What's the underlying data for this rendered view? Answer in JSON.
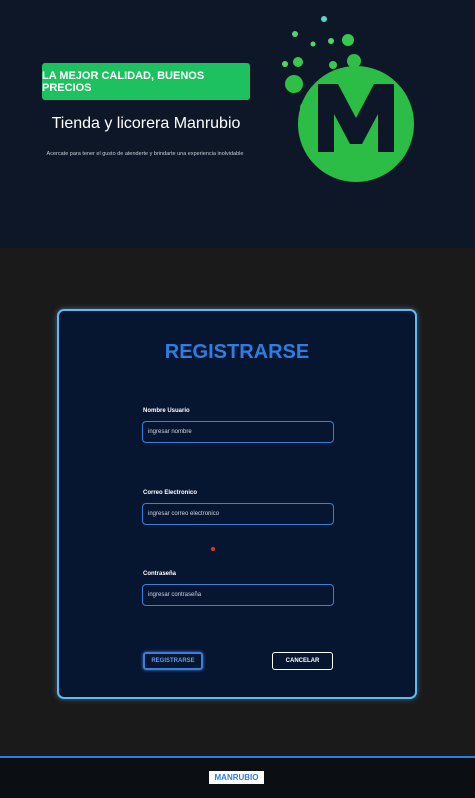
{
  "hero": {
    "badge": "LA MEJOR CALIDAD, BUENOS PRECIOS",
    "title": "Tienda y licorera Manrubio",
    "subtitle": "Acercate para tener el gusto de atenderte y brindarte una experiencia inolvidable"
  },
  "logo": {
    "letter": "M"
  },
  "form": {
    "title": "REGISTRARSE",
    "fields": [
      {
        "label": "Nombre Usuario",
        "placeholder": "ingresar nombre"
      },
      {
        "label": "Correo Electronico",
        "placeholder": "ingresar correo electronico"
      },
      {
        "label": "Contraseña",
        "placeholder": "ingresar contraseña"
      }
    ],
    "submit_label": "REGISTRARSE",
    "cancel_label": "CANCELAR"
  },
  "footer": {
    "brand": "MANRUBIO"
  },
  "colors": {
    "accent": "#2f7de1",
    "green": "#1ec15f",
    "card_border": "#62b9f0"
  }
}
